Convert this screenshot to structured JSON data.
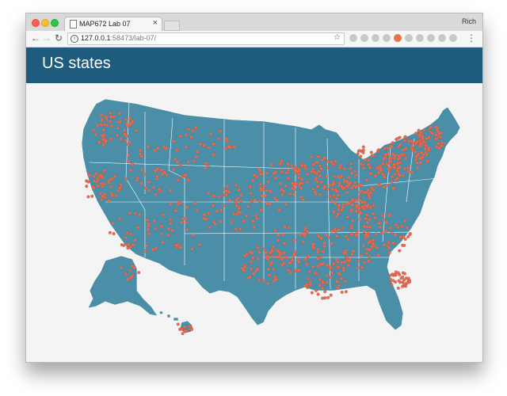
{
  "browser": {
    "tab_title": "MAP672 Lab 07",
    "tab_close": "×",
    "profile_name": "Rich",
    "url_host": "127.0.0.1",
    "url_rest": ":58473/lab-07/"
  },
  "page": {
    "heading": "US states"
  },
  "colors": {
    "header": "#1f5b7c",
    "state_fill": "#4a8ea8",
    "state_border": "#ffffff",
    "point": "#e76f51"
  },
  "map": {
    "layer": "us-states",
    "overlay": "point-locations",
    "icons": [
      "page-icon",
      "back-icon",
      "forward-icon",
      "reload-icon",
      "info-icon",
      "star-icon",
      "menu-icon"
    ]
  }
}
